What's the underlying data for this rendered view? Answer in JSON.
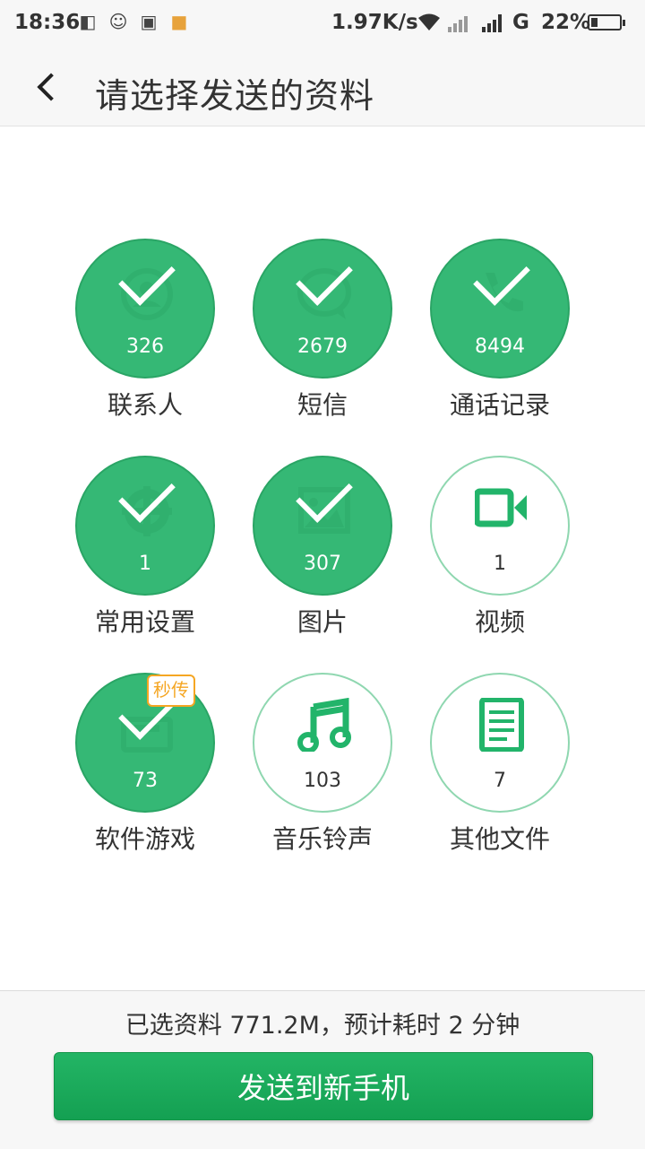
{
  "status_bar": {
    "time": "18:36",
    "speed": "1.97K/s",
    "network": "G",
    "battery": "22%",
    "battery_level": 0.22,
    "icons": [
      "wechat-icon",
      "qq-icon",
      "scan-icon",
      "app-icon",
      "wifi-icon",
      "signal-icon"
    ]
  },
  "header": {
    "title": "请选择发送的资料"
  },
  "items": [
    {
      "label": "联系人",
      "count": "326",
      "selected": true,
      "icon": "contact-icon"
    },
    {
      "label": "短信",
      "count": "2679",
      "selected": true,
      "icon": "message-icon"
    },
    {
      "label": "通话记录",
      "count": "8494",
      "selected": true,
      "icon": "phone-icon"
    },
    {
      "label": "常用设置",
      "count": "1",
      "selected": true,
      "icon": "gear-icon"
    },
    {
      "label": "图片",
      "count": "307",
      "selected": true,
      "icon": "image-icon"
    },
    {
      "label": "视频",
      "count": "1",
      "selected": false,
      "icon": "video-icon"
    },
    {
      "label": "软件游戏",
      "count": "73",
      "selected": true,
      "icon": "app-icon",
      "badge": "秒传"
    },
    {
      "label": "音乐铃声",
      "count": "103",
      "selected": false,
      "icon": "music-icon"
    },
    {
      "label": "其他文件",
      "count": "7",
      "selected": false,
      "icon": "document-icon"
    }
  ],
  "footer": {
    "summary": "已选资料 771.2M，预计耗时 2 分钟",
    "send_label": "发送到新手机"
  },
  "colors": {
    "accent": "#35b875",
    "badge": "#f5a623",
    "button": "#1aa858"
  }
}
